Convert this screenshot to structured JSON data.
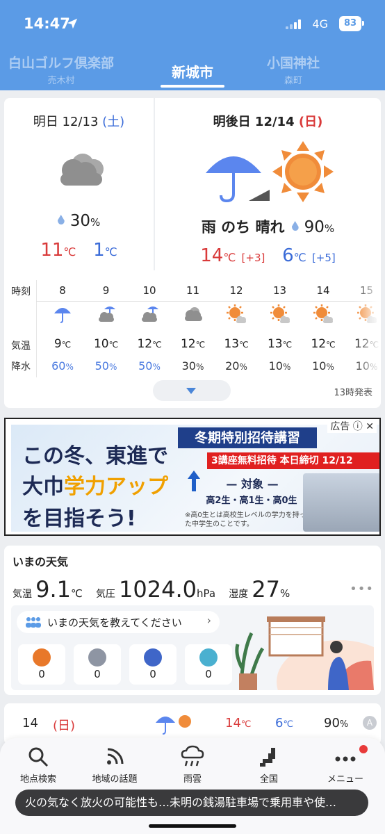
{
  "status_bar": {
    "time": "14:47",
    "network": "4G",
    "battery": "83"
  },
  "location_tabs": [
    {
      "name": "白山ゴルフ倶楽部",
      "sub": "売木村"
    },
    {
      "name": "新城市",
      "sub": ""
    },
    {
      "name": "小国神社",
      "sub": "森町"
    }
  ],
  "forecast": {
    "tomorrow": {
      "label": "明日 12/13",
      "dow": "(土)",
      "pop": "30",
      "pop_unit": "%",
      "high": "11",
      "low": "1",
      "temp_unit": "℃"
    },
    "day_after": {
      "label": "明後日 12/14",
      "dow": "(日)",
      "desc": "雨 のち 晴れ",
      "pop": "90",
      "pop_unit": "%",
      "high": "14",
      "high_diff": "[+3]",
      "low": "6",
      "low_diff": "[+5]",
      "temp_unit": "℃"
    },
    "hourly_labels": {
      "time": "時刻",
      "temp": "気温",
      "precip": "降水"
    },
    "hourly": [
      {
        "hour": "8",
        "icon": "umbrella-icon",
        "temp": "9",
        "pop": "60",
        "blue": true
      },
      {
        "hour": "9",
        "icon": "cloud-rain-icon",
        "temp": "10",
        "pop": "50",
        "blue": true
      },
      {
        "hour": "10",
        "icon": "cloud-rain-icon",
        "temp": "12",
        "pop": "50",
        "blue": true
      },
      {
        "hour": "11",
        "icon": "cloud-icon",
        "temp": "12",
        "pop": "30",
        "blue": false
      },
      {
        "hour": "12",
        "icon": "sun-cloud-icon",
        "temp": "13",
        "pop": "20",
        "blue": false
      },
      {
        "hour": "13",
        "icon": "sun-cloud-icon",
        "temp": "13",
        "pop": "10",
        "blue": false
      },
      {
        "hour": "14",
        "icon": "sun-cloud-icon",
        "temp": "12",
        "pop": "10",
        "blue": false
      },
      {
        "hour": "15",
        "icon": "sun-cloud-icon",
        "temp": "12",
        "pop": "10",
        "blue": false
      }
    ],
    "temp_unit": "℃",
    "pop_unit": "%",
    "issued": "13時発表"
  },
  "ad": {
    "tag": "広告",
    "line1": "この冬、東進で",
    "line2_a": "大巾",
    "line2_b": "学力アップ",
    "line3": "を目指そう!",
    "banner": "冬期特別招待講習",
    "red": "3講座無料招待 本日締切 12/12",
    "target": "— 対象 —",
    "grades": "高2生・高1生・高0生",
    "note": "※高0生とは高校生レベルの学力を持った中学生のことです。"
  },
  "current": {
    "title": "いまの天気",
    "temp_label": "気温",
    "temp": "9.1",
    "temp_unit": "℃",
    "pressure_label": "気圧",
    "pressure": "1024.0",
    "pressure_unit": "hPa",
    "humidity_label": "湿度",
    "humidity": "27",
    "humidity_unit": "%",
    "ask": "いまの天気を教えてください",
    "votes": [
      {
        "icon": "sun-vote-icon",
        "count": "0",
        "color": "#e8782a"
      },
      {
        "icon": "cloud-vote-icon",
        "count": "0",
        "color": "#8e95a3"
      },
      {
        "icon": "rain-vote-icon",
        "count": "0",
        "color": "#3f66c8"
      },
      {
        "icon": "snow-vote-icon",
        "count": "0",
        "color": "#4ab0d0"
      }
    ]
  },
  "weekly": {
    "day": "14",
    "dow": "(日)",
    "high": "14",
    "low": "6",
    "pop": "90",
    "temp_unit": "℃",
    "pop_unit": "%",
    "badge": "A"
  },
  "bottom_nav": [
    {
      "label": "地点検索",
      "icon": "search-icon"
    },
    {
      "label": "地域の話題",
      "icon": "rss-icon"
    },
    {
      "label": "雨雲",
      "icon": "rain-cloud-icon"
    },
    {
      "label": "全国",
      "icon": "map-icon"
    },
    {
      "label": "メニュー",
      "icon": "more-icon"
    }
  ],
  "news_ticker": "火の気なく放火の可能性も…未明の銭湯駐車場で乗用車や使…",
  "colors": {
    "header": "#5b9be6",
    "rain_blue": "#5b86ee",
    "sun_orange": "#f08c3a",
    "high": "#d93a3a",
    "low": "#3a6bd8"
  }
}
